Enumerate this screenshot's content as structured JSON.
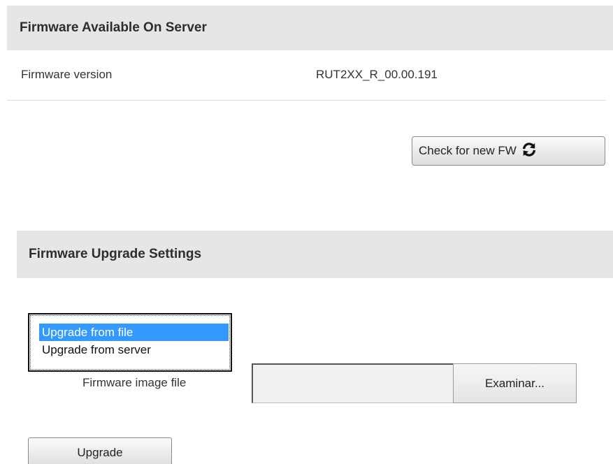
{
  "server_section": {
    "title": "Firmware Available On Server",
    "fw_label": "Firmware version",
    "fw_value": "RUT2XX_R_00.00.191",
    "check_button_label": "Check for new FW",
    "check_button_icon": "refresh-icon"
  },
  "upgrade_section": {
    "title": "Firmware Upgrade Settings",
    "source_options": [
      "Upgrade from file",
      "Upgrade from server"
    ],
    "selected_source": "Upgrade from file",
    "file_label": "Firmware image file",
    "file_value": "",
    "browse_label": "Examinar...",
    "upgrade_label": "Upgrade"
  },
  "colors": {
    "header_bg": "#e6e6e6",
    "selection": "#3399ff"
  }
}
